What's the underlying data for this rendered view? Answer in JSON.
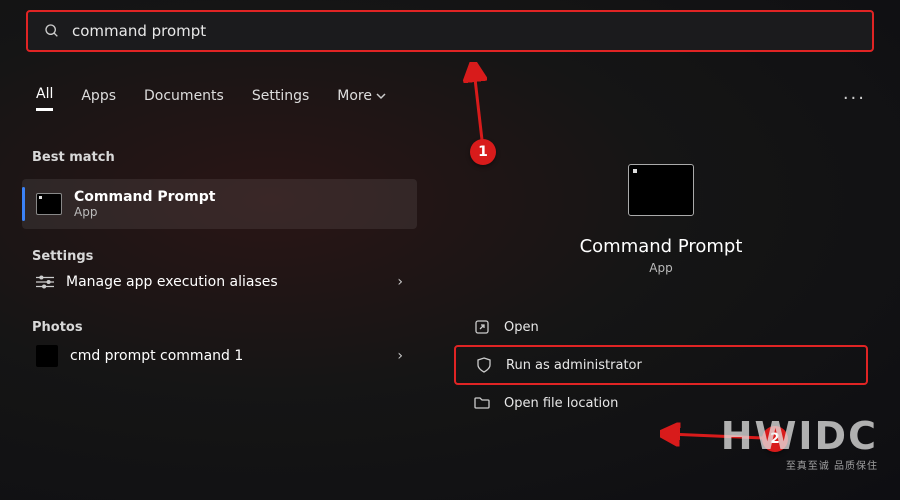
{
  "search": {
    "query": "command prompt"
  },
  "tabs": {
    "all": "All",
    "apps": "Apps",
    "documents": "Documents",
    "settings": "Settings",
    "more": "More"
  },
  "left": {
    "best_match_label": "Best match",
    "best_match": {
      "title": "Command Prompt",
      "subtitle": "App"
    },
    "settings_label": "Settings",
    "settings_items": [
      {
        "title": "Manage app execution aliases"
      }
    ],
    "photos_label": "Photos",
    "photos_items": [
      {
        "title": "cmd prompt command 1"
      }
    ]
  },
  "preview": {
    "title": "Command Prompt",
    "subtitle": "App",
    "actions": {
      "open": "Open",
      "run_admin": "Run as administrator",
      "open_location": "Open file location"
    }
  },
  "annotations": {
    "callout1": "1",
    "callout2": "2"
  },
  "watermark": {
    "main": "HWIDC",
    "sub": "至真至诚 品质保住"
  }
}
